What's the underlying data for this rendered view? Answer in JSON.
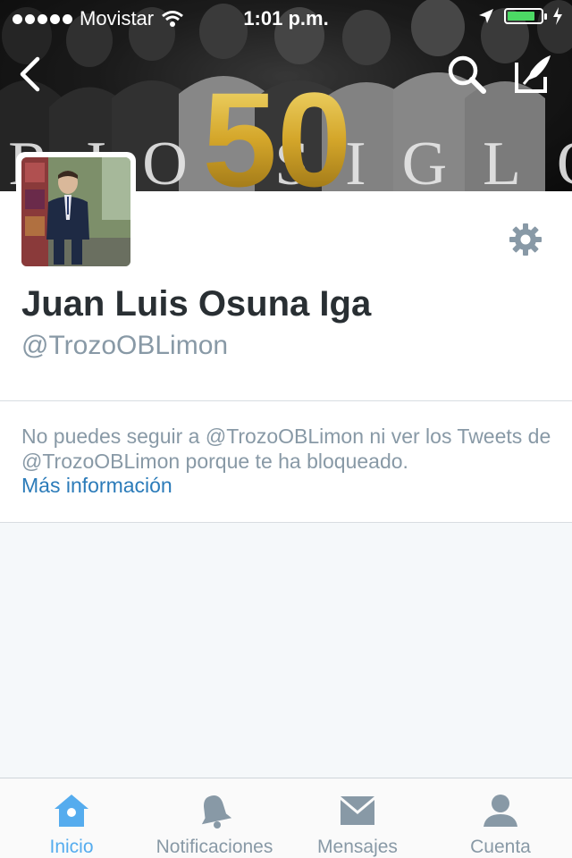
{
  "status_bar": {
    "carrier": "Movistar",
    "time": "1:01 p.m.",
    "battery_level": 0.85
  },
  "banner": {
    "number": "50",
    "text": "ERIO SIGLO"
  },
  "header_icons": {
    "back": "chevron-left-icon",
    "search": "search-icon",
    "compose": "compose-tweet-icon"
  },
  "profile": {
    "name": "Juan Luis Osuna Iga",
    "handle": "@TrozoOBLimon",
    "settings_icon": "gear-icon"
  },
  "blocked": {
    "message": "No puedes seguir a @TrozoOBLimon ni ver los Tweets de @TrozoOBLimon porque te ha bloqueado.",
    "link": "Más información"
  },
  "tabs": [
    {
      "label": "Inicio",
      "icon": "home-icon",
      "active": true
    },
    {
      "label": "Notificaciones",
      "icon": "bell-icon",
      "active": false
    },
    {
      "label": "Mensajes",
      "icon": "envelope-icon",
      "active": false
    },
    {
      "label": "Cuenta",
      "icon": "person-icon",
      "active": false
    }
  ],
  "colors": {
    "accent": "#55acee",
    "link": "#2b7bb9",
    "muted": "#8899a6",
    "text": "#292f33",
    "battery": "#4cd964"
  }
}
